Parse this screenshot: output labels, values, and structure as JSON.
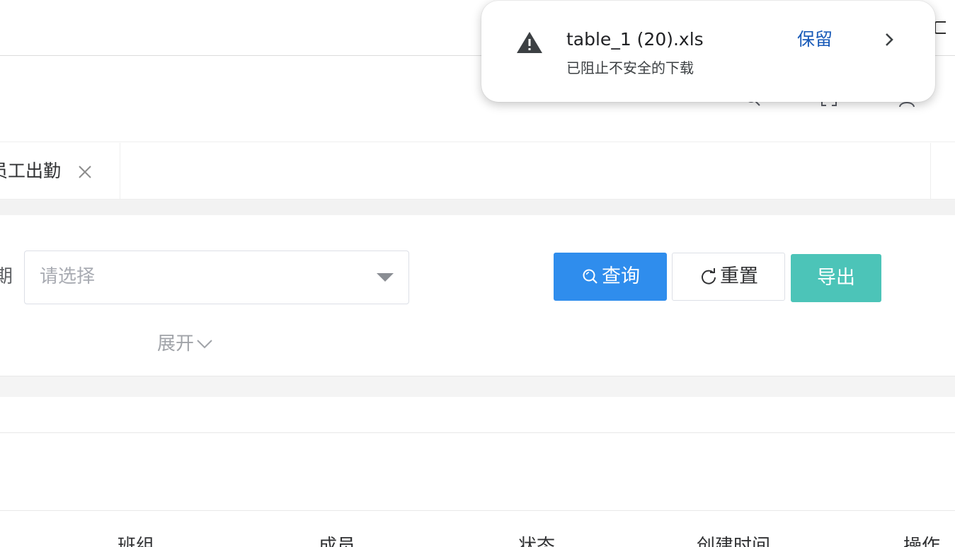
{
  "tags": {
    "active_tag": "员工出勤"
  },
  "search": {
    "field_label_partial": "期",
    "select_placeholder": "请选择",
    "query_label": "查询",
    "reset_label": "重置",
    "export_label": "导出",
    "expand_label": "展开"
  },
  "table": {
    "headers": [
      "班组",
      "成员",
      "状态",
      "创建时间",
      "操作"
    ]
  },
  "download": {
    "filename": "table_1 (20).xls",
    "status": "已阻止不安全的下载",
    "keep_label": "保留"
  },
  "colors": {
    "primary": "#2f8ded",
    "export": "#4cc4b8",
    "link": "#1a5bb8"
  },
  "icons": {
    "warning": "warning-icon",
    "search": "search-icon",
    "reset": "refresh-icon",
    "close": "close-icon",
    "caret": "caret-down-icon",
    "expand": "chevron-down-icon",
    "more": "chevron-right-icon"
  }
}
